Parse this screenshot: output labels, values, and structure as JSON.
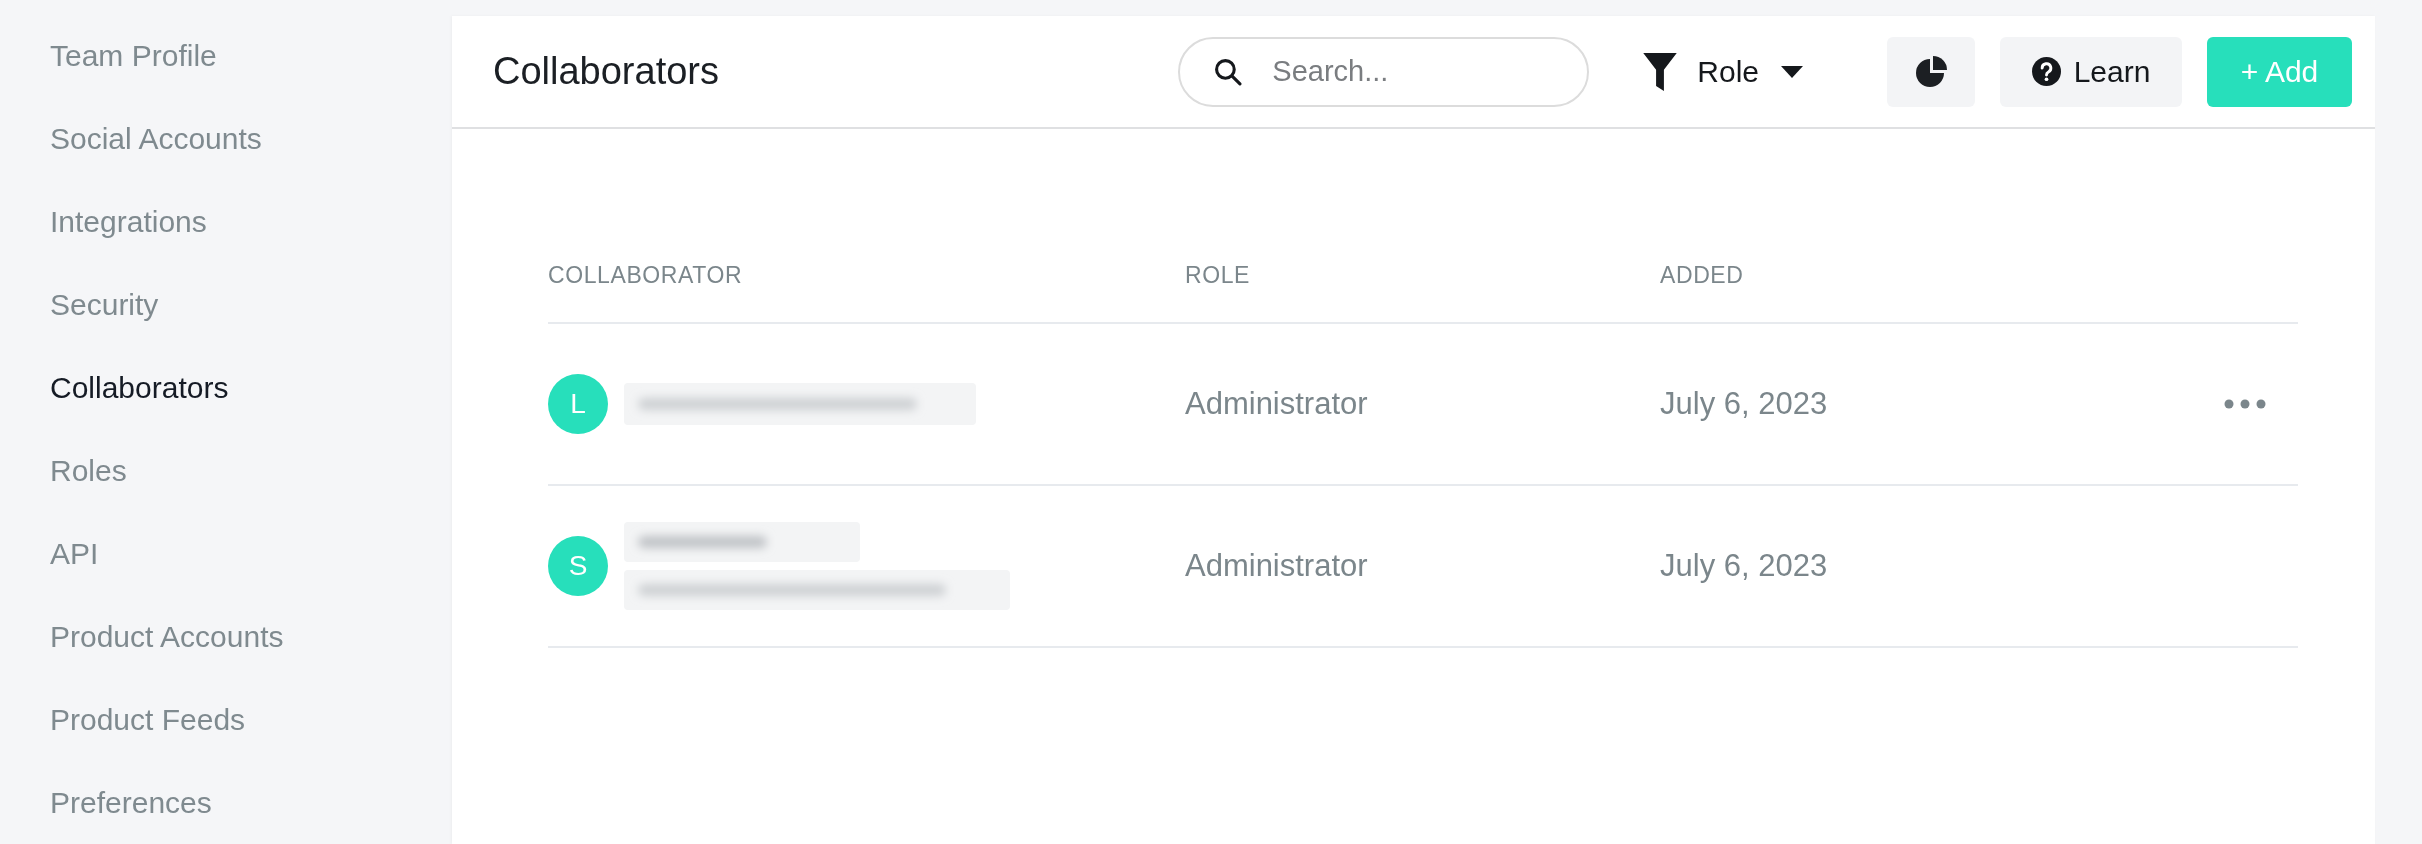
{
  "sidebar": {
    "items": [
      {
        "label": "Team Profile",
        "selected": false
      },
      {
        "label": "Social Accounts",
        "selected": false
      },
      {
        "label": "Integrations",
        "selected": false
      },
      {
        "label": "Security",
        "selected": false
      },
      {
        "label": "Collaborators",
        "selected": true
      },
      {
        "label": "Roles",
        "selected": false
      },
      {
        "label": "API",
        "selected": false
      },
      {
        "label": "Product Accounts",
        "selected": false
      },
      {
        "label": "Product Feeds",
        "selected": false
      },
      {
        "label": "Preferences",
        "selected": false
      }
    ]
  },
  "header": {
    "title": "Collaborators",
    "search": {
      "placeholder": "Search..."
    },
    "role_filter": {
      "label": "Role"
    },
    "buttons": [
      {
        "kind": "chart"
      },
      {
        "kind": "help",
        "label": "Learn"
      },
      {
        "kind": "primary",
        "label": "+ Add"
      }
    ]
  },
  "table": {
    "columns": [
      "COLLABORATOR",
      "ROLE",
      "ADDED"
    ],
    "rows": [
      {
        "avatar": "L",
        "redacted_lines": [
          {
            "kind": "email"
          }
        ],
        "role": "Administrator",
        "added": "July 6, 2023",
        "actions_visible": true
      },
      {
        "avatar": "S",
        "redacted_lines": [
          {
            "kind": "name"
          },
          {
            "kind": "email"
          }
        ],
        "role": "Administrator",
        "added": "July 6, 2023",
        "actions_visible": false
      }
    ]
  }
}
